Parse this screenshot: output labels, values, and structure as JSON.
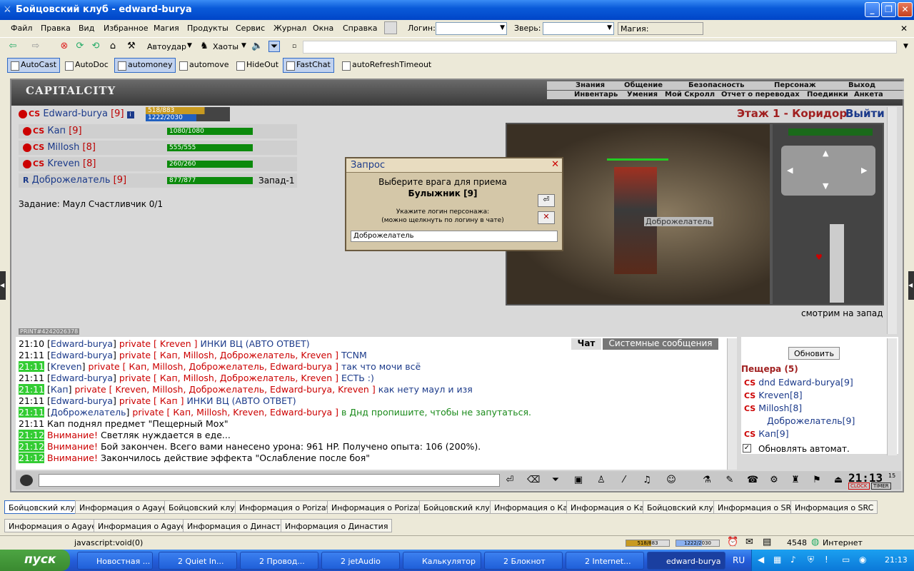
{
  "window": {
    "title": "Бойцовский клуб - edward-burya"
  },
  "menu": {
    "items": [
      "Файл",
      "Правка",
      "Вид",
      "Избранное",
      "Магия",
      "Продукты",
      "Сервис",
      "Журнал",
      "Окна",
      "Справка"
    ],
    "login_label": "Логин:",
    "beast_label": "Зверь:",
    "magic_label": "Магия:"
  },
  "toolbar": {
    "autoudar": "Автоудар",
    "haos": "Хаоты"
  },
  "plugins": [
    "AutoCast",
    "AutoDoc",
    "automoney",
    "automove",
    "HideOut",
    "FastChat",
    "autoRefreshTimeout"
  ],
  "plugins_on": [
    true,
    false,
    true,
    false,
    false,
    true,
    false
  ],
  "game": {
    "logo": "CAPITALCITY",
    "nav1": [
      "Знания",
      "Общение",
      "Безопасность",
      "Персонаж",
      "Выход"
    ],
    "nav2": [
      "Инвентарь",
      "Умения",
      "Мой Скролл",
      "Отчет о переводах",
      "Поединки",
      "Анкета"
    ],
    "self": {
      "name": "Edward-burya",
      "level": "[9]",
      "hp": "518/883",
      "mana": "1222/2030"
    },
    "party": [
      {
        "clan": "CS",
        "name": "Кап",
        "level": "[9]",
        "hp": "1080/1080",
        "extra": ""
      },
      {
        "clan": "CS",
        "name": "Millosh",
        "level": "[8]",
        "hp": "555/555",
        "extra": ""
      },
      {
        "clan": "CS",
        "name": "Kreven",
        "level": "[8]",
        "hp": "260/260",
        "extra": ""
      },
      {
        "clan": "R",
        "name": "Доброжелатель",
        "level": "[9]",
        "hp": "877/877",
        "extra": "Запад-1"
      }
    ],
    "quest": "Задание: Маул Счастливчик 0/1",
    "location": "Этаж 1 - Коридор",
    "exit": "Выйти",
    "view_caption": "смотрим на запад",
    "npc_label": "Доброжелатель",
    "print_id": "PRINT#4242026378"
  },
  "dialog": {
    "title": "Запрос",
    "line1": "Выберите врага для приема",
    "line2": "Булыжник [9]",
    "hint1": "Укажите логин персонажа:",
    "hint2": "(можно щелкнуть по логину в чате)",
    "value": "Доброжелатель"
  },
  "chat_tabs": {
    "chat": "Чат",
    "system": "Системные сообщения"
  },
  "chat": [
    {
      "t": "21:10",
      "g": false,
      "n": "Edward-burya",
      "p": "private [ Kreven ]",
      "m": "ИНКИ ВЦ (АВТО ОТВЕТ)",
      "c": "msg"
    },
    {
      "t": "21:11",
      "g": false,
      "n": "Edward-burya",
      "p": "private [ Кап, Millosh, Доброжелатель, Kreven ]",
      "m": "TCNM",
      "c": "msg"
    },
    {
      "t": "21:11",
      "g": true,
      "n": "Kreven",
      "p": "private [ Кап, Millosh, Доброжелатель, Edward-burya ]",
      "m": "так что мочи всё",
      "c": "msg"
    },
    {
      "t": "21:11",
      "g": false,
      "n": "Edward-burya",
      "p": "private [ Кап, Millosh, Доброжелатель, Kreven ]",
      "m": "ЕСТЬ :)",
      "c": "msg"
    },
    {
      "t": "21:11",
      "g": true,
      "n": "Кап",
      "p": "private [ Kreven, Millosh, Доброжелатель, Edward-burya, Kreven ]",
      "m": "как нету маул и изя",
      "c": "msg"
    },
    {
      "t": "21:11",
      "g": false,
      "n": "Edward-burya",
      "p": "private [ Кап ]",
      "m": "ИНКИ ВЦ (АВТО ОТВЕТ)",
      "c": "msg"
    },
    {
      "t": "21:11",
      "g": true,
      "n": "Доброжелатель",
      "p": "private [ Кап, Millosh, Kreven, Edward-burya ]",
      "m": "в Днд пропишите, чтобы не запутаться.",
      "c": "msgg"
    }
  ],
  "sys": [
    {
      "t": "21:11",
      "g": false,
      "text": "Кап поднял предмет \"Пещерный Мох\""
    },
    {
      "t": "21:12",
      "g": true,
      "warn": "Внимание!",
      "text": "Светляк нуждается в еде..."
    },
    {
      "t": "21:12",
      "g": true,
      "warn": "Внимание!",
      "text": "Бой закончен. Всего вами нанесено урона: 961 HP. Получено опыта: 106 (200%)."
    },
    {
      "t": "21:12",
      "g": true,
      "warn": "Внимание!",
      "text": "Закончилось действие эффекта \"Ослабление после боя\""
    }
  ],
  "right_panel": {
    "refresh": "Обновить",
    "room": "Пещера (5)",
    "members": [
      "dnd Edward-burya[9]",
      "Kreven[8]",
      "Millosh[8]",
      "Доброжелатель[9]",
      "Кап[9]"
    ],
    "auto": "Обновлять автомат."
  },
  "clock": {
    "time": "21:13",
    "sec": "15",
    "clock_label": "CLOCK",
    "timer_label": "TIMER"
  },
  "tabs1": [
    "Бойцовский клуб",
    "Информация о Agayev",
    "Бойцовский клуб",
    "Информация о Porizatel",
    "Информация о Porizatel",
    "Бойцовский клуб",
    "Информация о Кап",
    "Информация о Кап",
    "Бойцовский клуб",
    "Информация о SRC",
    "Информация о SRC"
  ],
  "tabs2": [
    "Информация о Agayev",
    "Информация о Agayev",
    "Информация о Династия",
    "Информация о Династия"
  ],
  "status": {
    "url": "javascript:void(0)",
    "hp": "518/883",
    "mana": "1222/2030",
    "num": "4548",
    "zone": "Интернет"
  },
  "taskbar": {
    "start": "пуск",
    "tasks": [
      "Новостная ...",
      "2 Quiet In...",
      "2 Провод...",
      "2 jetAudio",
      "Калькулятор",
      "2 Блокнот",
      "2 Internet...",
      "edward-burya"
    ],
    "lang": "RU",
    "time": "21:13"
  }
}
